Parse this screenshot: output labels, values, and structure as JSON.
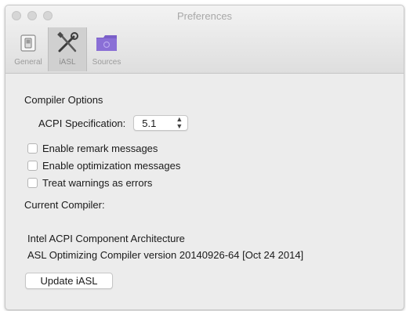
{
  "window": {
    "title": "Preferences"
  },
  "toolbar": {
    "items": [
      {
        "label": "General",
        "icon": "general-switch-icon",
        "selected": false
      },
      {
        "label": "iASL",
        "icon": "tools-icon",
        "selected": true
      },
      {
        "label": "Sources",
        "icon": "folder-icon",
        "selected": false
      }
    ]
  },
  "compiler_options": {
    "title": "Compiler Options",
    "acpi_label": "ACPI Specification:",
    "acpi_value": "5.1",
    "checkboxes": [
      {
        "label": "Enable remark messages",
        "checked": false
      },
      {
        "label": "Enable optimization messages",
        "checked": false
      },
      {
        "label": "Treat warnings as errors",
        "checked": false
      }
    ]
  },
  "current_compiler": {
    "title": "Current Compiler:",
    "line1": "Intel ACPI Component Architecture",
    "line2": "ASL Optimizing Compiler version 20140926-64 [Oct 24 2014]"
  },
  "update_button": {
    "label": "Update iASL"
  },
  "colors": {
    "folder": "#8a6fd6",
    "folder_tab": "#7a5fc8"
  }
}
